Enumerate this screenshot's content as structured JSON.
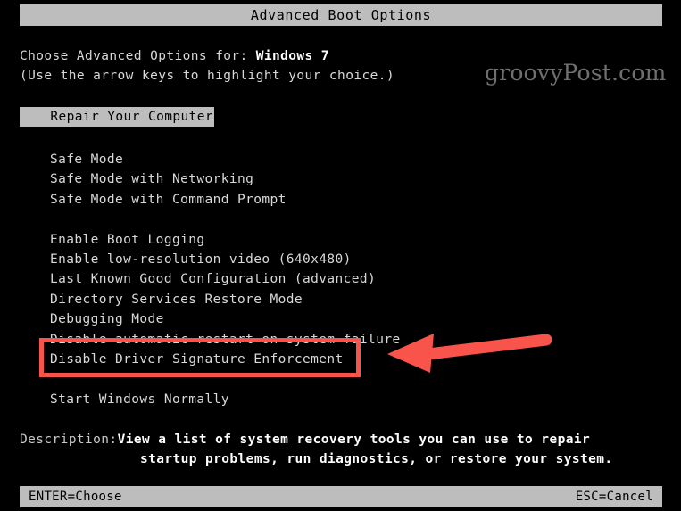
{
  "screen": {
    "title": "Advanced Boot Options",
    "background_color": "#000000",
    "bar_color": "#bdbdbd",
    "text_color": "#d8d8d8",
    "accent_color": "#f9544b"
  },
  "intro": {
    "line1_prefix": "Choose Advanced Options for: ",
    "os_name": "Windows 7",
    "line2": "(Use the arrow keys to highlight your choice.)"
  },
  "watermark": {
    "text": "groovyPost.com"
  },
  "highlighted_row": {
    "label": "Repair Your Computer"
  },
  "menu": {
    "items": [
      {
        "label": "Safe Mode",
        "spacer_after": false
      },
      {
        "label": "Safe Mode with Networking",
        "spacer_after": false
      },
      {
        "label": "Safe Mode with Command Prompt",
        "spacer_after": true
      },
      {
        "label": "Enable Boot Logging",
        "spacer_after": false
      },
      {
        "label": "Enable low-resolution video (640x480)",
        "spacer_after": false
      },
      {
        "label": "Last Known Good Configuration (advanced)",
        "spacer_after": false
      },
      {
        "label": "Directory Services Restore Mode",
        "spacer_after": false
      },
      {
        "label": "Debugging Mode",
        "spacer_after": false
      },
      {
        "label": "Disable automatic restart on system failure",
        "spacer_after": false
      },
      {
        "label": "Disable Driver Signature Enforcement",
        "spacer_after": true
      },
      {
        "label": "Start Windows Normally",
        "spacer_after": false
      }
    ]
  },
  "annotation": {
    "boxed_item_label": "Disable Driver Signature Enforcement",
    "arrow_direction": "left",
    "color": "#f9544b"
  },
  "description": {
    "label": "Description:",
    "line1": "View a list of system recovery tools you can use to repair",
    "line2": "startup problems, run diagnostics, or restore your system."
  },
  "statusbar": {
    "left": "ENTER=Choose",
    "right": "ESC=Cancel"
  }
}
